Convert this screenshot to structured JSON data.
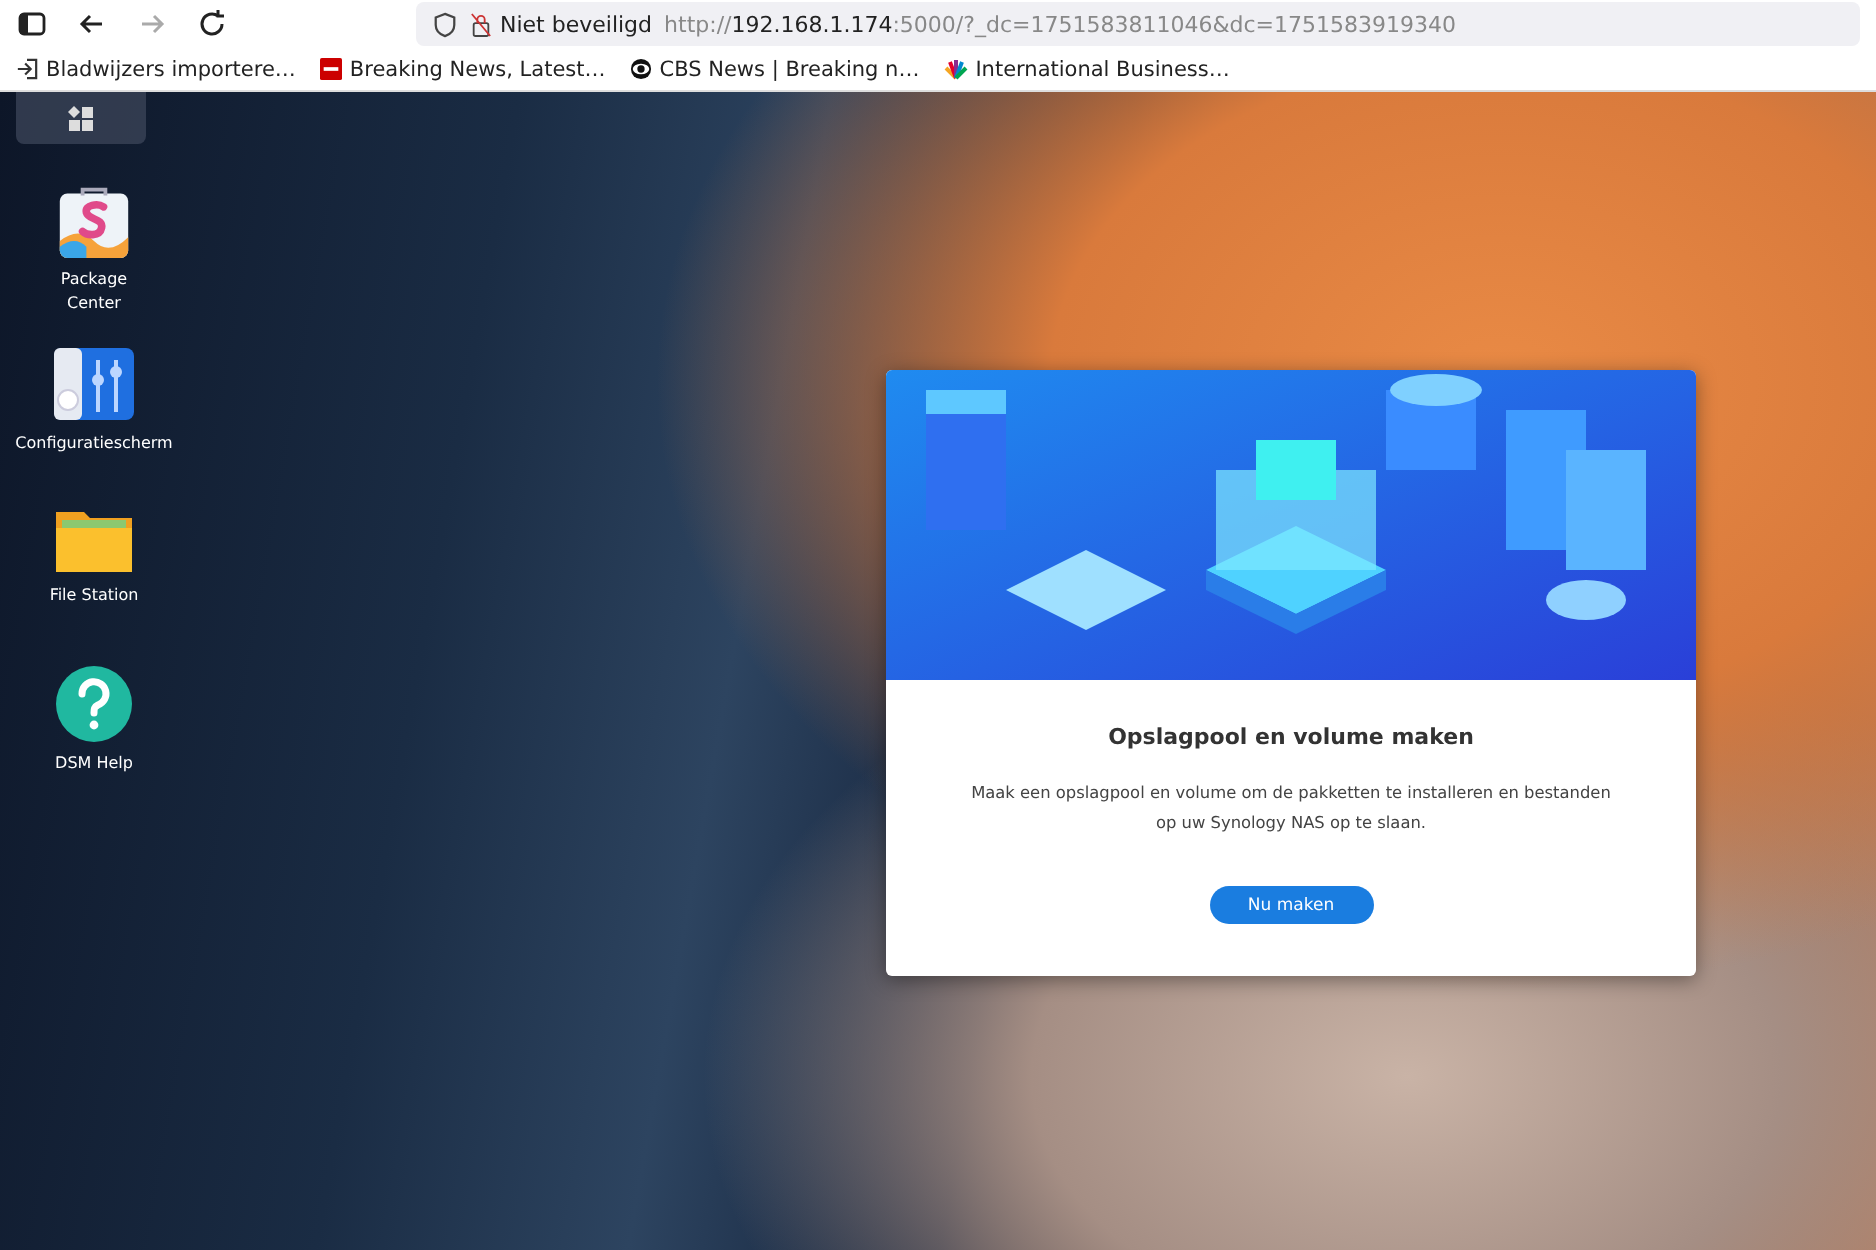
{
  "browser": {
    "security": "Niet beveiligd",
    "url": {
      "prefix": "http://",
      "host": "192.168.1.174",
      "suffix": ":5000/?_dc=1751583811046&dc=1751583919340"
    }
  },
  "bookmarks": [
    {
      "kind": "import",
      "label": "Bladwijzers importere…"
    },
    {
      "kind": "cnn",
      "label": "Breaking News, Latest…"
    },
    {
      "kind": "cbs",
      "label": "CBS News | Breaking n…"
    },
    {
      "kind": "nbc",
      "label": "International Business…"
    }
  ],
  "desktop": {
    "icons": [
      {
        "kind": "package",
        "label": "Package\nCenter"
      },
      {
        "kind": "control",
        "label": "Configuratiescherm"
      },
      {
        "kind": "folder",
        "label": "File Station"
      },
      {
        "kind": "help",
        "label": "DSM Help"
      }
    ]
  },
  "dialog": {
    "title": "Opslagpool en volume maken",
    "text": "Maak een opslagpool en volume om de pakketten te installeren en bestanden op uw Synology NAS op te slaan.",
    "button": "Nu maken"
  }
}
